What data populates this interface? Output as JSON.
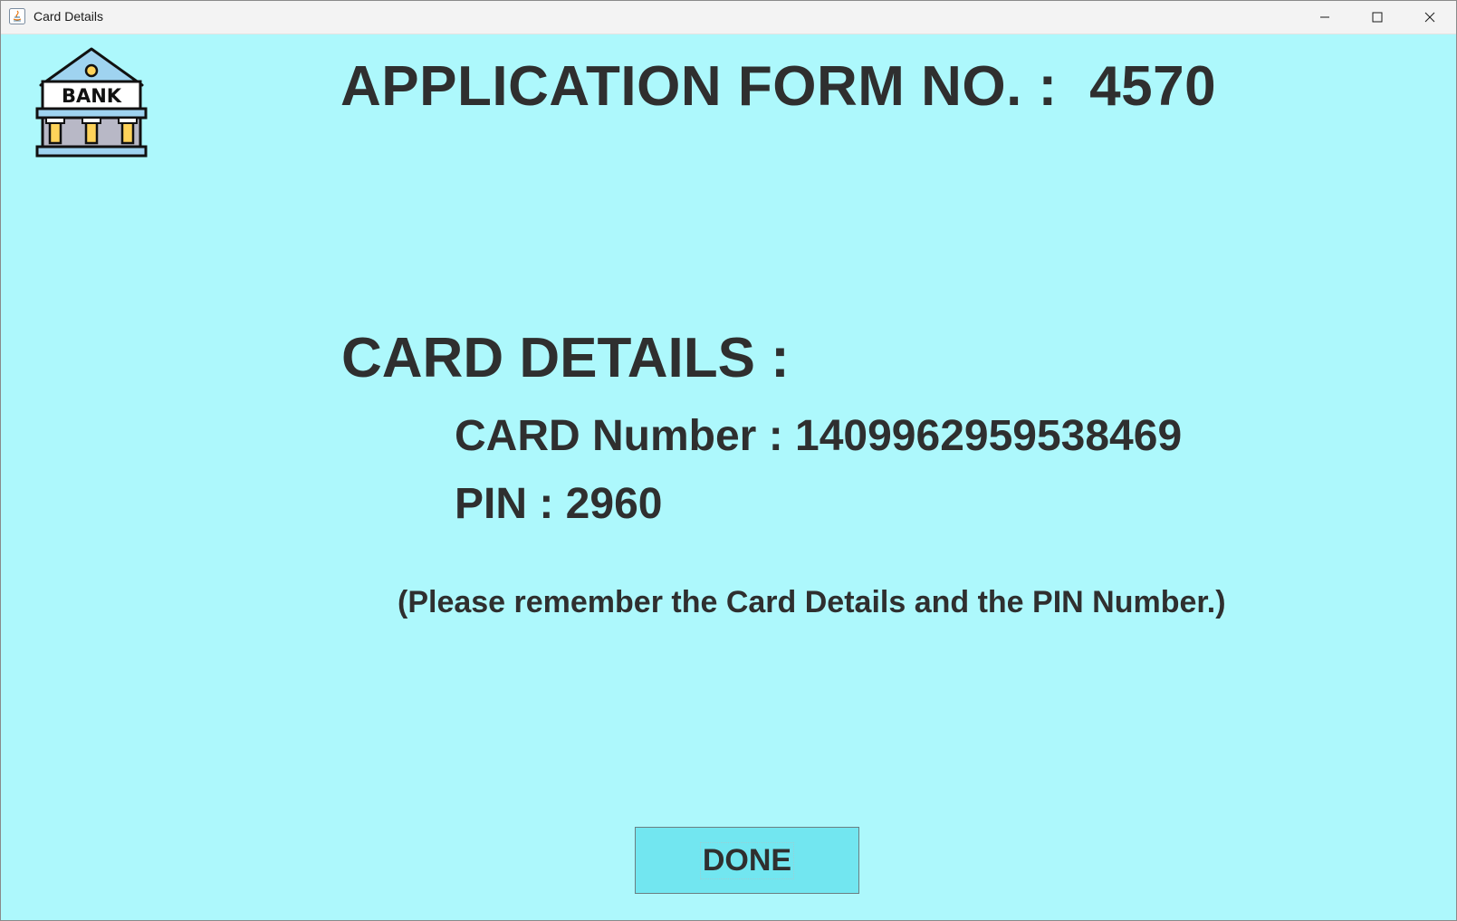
{
  "window": {
    "title": "Card Details"
  },
  "header": {
    "form_label": "APPLICATION FORM NO. :  ",
    "form_number": "4570"
  },
  "card": {
    "heading": "CARD DETAILS :",
    "number_label": "CARD Number : ",
    "number_value": "1409962959538469",
    "pin_label": "PIN : ",
    "pin_value": "2960",
    "note": "(Please remember the Card Details and the PIN Number.)"
  },
  "actions": {
    "done_label": "DONE"
  },
  "logo": {
    "text": "BANK"
  },
  "colors": {
    "background": "#adf8fc",
    "button": "#72e6f0",
    "text": "#2f2f2f"
  }
}
